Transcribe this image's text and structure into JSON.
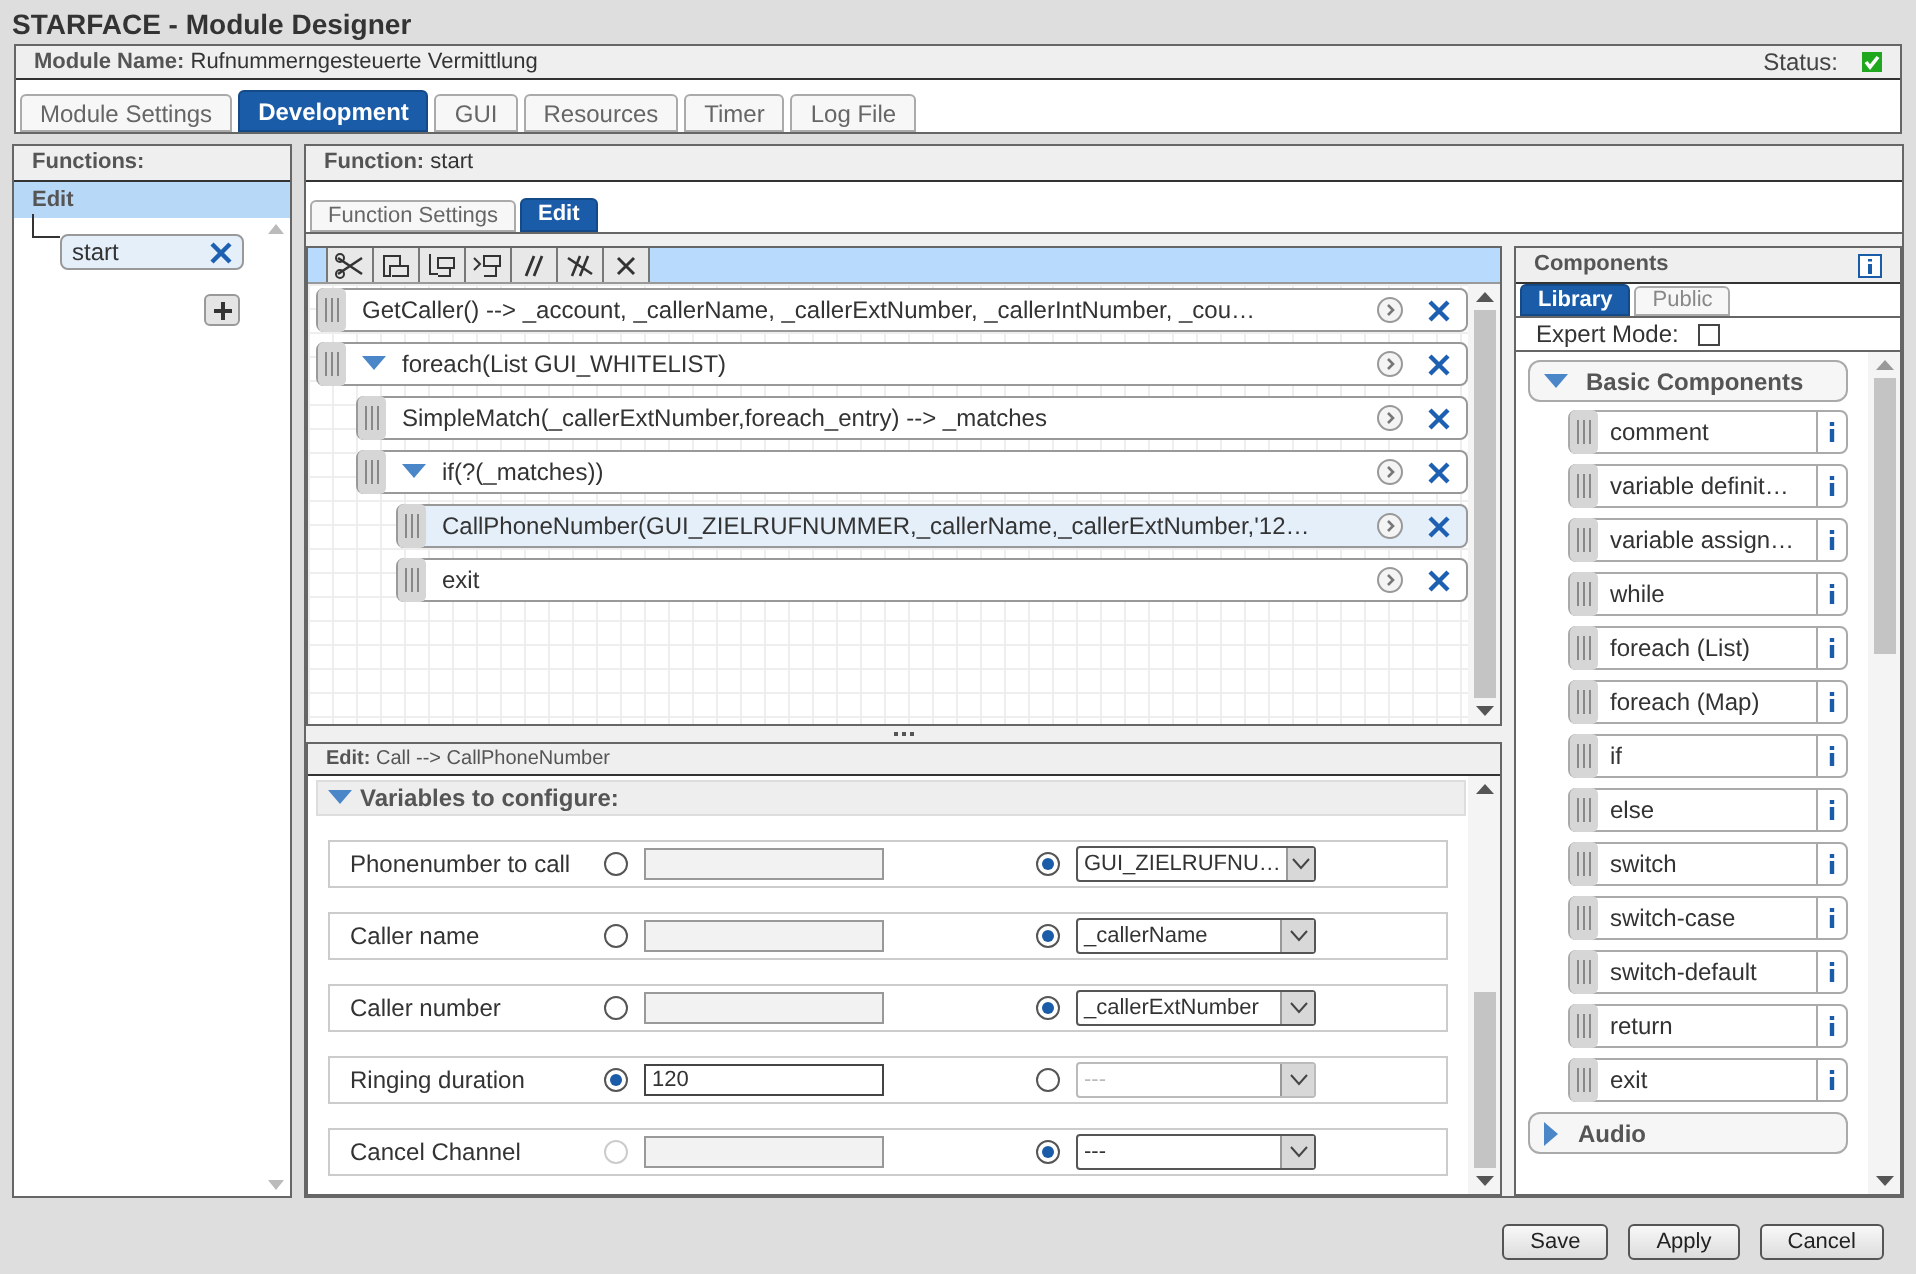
{
  "window": {
    "title": "STARFACE - Module Designer"
  },
  "module": {
    "label": "Module Name:",
    "name": "Rufnummerngesteuerte Vermittlung",
    "status_label": "Status:",
    "status_ok": true
  },
  "tabs": [
    {
      "label": "Module Settings",
      "selected": false
    },
    {
      "label": "Development",
      "selected": true
    },
    {
      "label": "GUI",
      "selected": false
    },
    {
      "label": "Resources",
      "selected": false
    },
    {
      "label": "Timer",
      "selected": false
    },
    {
      "label": "Log File",
      "selected": false
    }
  ],
  "functions": {
    "title": "Functions:",
    "header": "Edit",
    "items": [
      {
        "label": "start",
        "selected": true
      }
    ]
  },
  "function": {
    "label": "Function:",
    "name": "start",
    "tabs": [
      {
        "label": "Function Settings",
        "selected": false
      },
      {
        "label": "Edit",
        "selected": true
      }
    ]
  },
  "statements": [
    {
      "text": "GetCaller() --> _account, _callerName, _callerExtNumber, _callerIntNumber, _cou…",
      "selected": false
    },
    {
      "text": "foreach(List GUI_WHITELIST)",
      "selected": false,
      "expanded": true,
      "children": [
        {
          "text": "SimpleMatch(_callerExtNumber,foreach_entry) --> _matches",
          "selected": false
        },
        {
          "text": "if(?(_matches))",
          "selected": false,
          "expanded": true,
          "children": [
            {
              "text": "CallPhoneNumber(GUI_ZIELRUFNUMMER,_callerName,_callerExtNumber,'12…",
              "selected": true
            },
            {
              "text": "exit",
              "selected": false
            }
          ]
        }
      ]
    }
  ],
  "edit": {
    "label": "Edit:",
    "name": "Call --> CallPhoneNumber",
    "section": "Variables to configure:",
    "section_expanded": true,
    "rows": [
      {
        "label": "Phonenumber to call",
        "constant_selected": false,
        "constant_disabled": false,
        "variable_selected": true,
        "variable_value": "GUI_ZIELRUFNU…",
        "variable_disabled": false
      },
      {
        "label": "Caller name",
        "constant_selected": false,
        "constant_disabled": false,
        "variable_selected": true,
        "variable_value": "_callerName",
        "variable_disabled": false
      },
      {
        "label": "Caller number",
        "constant_selected": false,
        "constant_disabled": false,
        "variable_selected": true,
        "variable_value": "_callerExtNumber",
        "variable_disabled": false
      },
      {
        "label": "Ringing duration",
        "constant_selected": true,
        "constant_disabled": false,
        "constant_value": "120",
        "variable_selected": false,
        "variable_value": "---",
        "variable_disabled": true
      },
      {
        "label": "Cancel Channel",
        "constant_selected": false,
        "constant_disabled": true,
        "variable_selected": true,
        "variable_value": "---",
        "variable_disabled": false
      }
    ]
  },
  "components": {
    "title": "Components",
    "tabs": [
      {
        "label": "Library",
        "selected": true
      },
      {
        "label": "Public",
        "selected": false
      }
    ],
    "expert_mode_label": "Expert Mode:",
    "expert_mode": false,
    "groups": [
      {
        "title": "Basic Components",
        "expanded": true,
        "items": [
          "comment",
          "variable definit…",
          "variable assign…",
          "while",
          "foreach (List)",
          "foreach (Map)",
          "if",
          "else",
          "switch",
          "switch-case",
          "switch-default",
          "return",
          "exit"
        ]
      },
      {
        "title": "Audio",
        "expanded": false
      }
    ]
  },
  "buttons": [
    "Save",
    "Apply",
    "Cancel"
  ]
}
